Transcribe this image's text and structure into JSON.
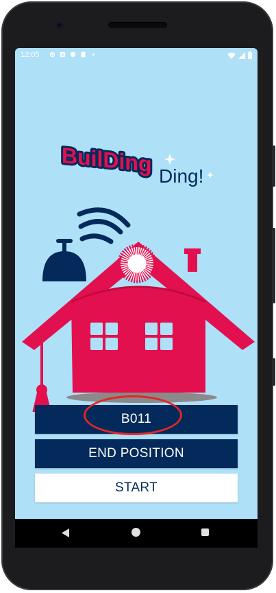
{
  "status_bar": {
    "time": "12:05",
    "left_icons": [
      "gear-icon",
      "app-icon",
      "shield-icon",
      "sd-card-icon",
      "dot-icon"
    ],
    "right_icons": [
      "wifi-icon",
      "signal-icon",
      "battery-icon"
    ]
  },
  "logo": {
    "line1": "BuilDing",
    "line2": "Ding!"
  },
  "buttons": {
    "room_code": "B011",
    "end_position": "END POSITION",
    "start": "START"
  },
  "colors": {
    "background": "#aee0f8",
    "brand_red": "#e3104f",
    "brand_navy": "#032a5a",
    "annotation_red": "#e52525"
  },
  "nav": {
    "icons": [
      "back-icon",
      "home-icon",
      "recents-icon"
    ]
  }
}
